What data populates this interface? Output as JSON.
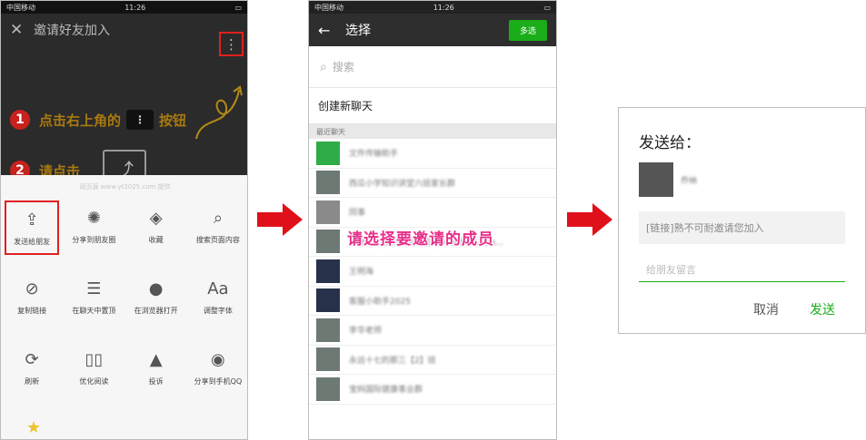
{
  "panel1": {
    "status": {
      "carrier": "中国移动",
      "time": "11:26"
    },
    "header": {
      "title": "邀请好友加入"
    },
    "step1": {
      "number": "1",
      "text_before": "点击右上角的",
      "text_after": "按钮"
    },
    "step2": {
      "number": "2",
      "text": "请点击"
    },
    "watermark": "阅页源 www.yt2025.com 提供",
    "menu": [
      {
        "label": "发送给朋友",
        "icon": "share-icon"
      },
      {
        "label": "分享到朋友圈",
        "icon": "moments-icon"
      },
      {
        "label": "收藏",
        "icon": "cube-icon"
      },
      {
        "label": "搜索页面内容",
        "icon": "search-icon"
      },
      {
        "label": "复制链接",
        "icon": "link-icon"
      },
      {
        "label": "在聊天中置顶",
        "icon": "pin-icon"
      },
      {
        "label": "在浏览器打开",
        "icon": "globe-icon"
      },
      {
        "label": "调整字体",
        "icon": "font-icon"
      },
      {
        "label": "刷新",
        "icon": "refresh-icon"
      },
      {
        "label": "优化阅读",
        "icon": "book-icon"
      },
      {
        "label": "投诉",
        "icon": "warning-icon"
      },
      {
        "label": "分享到手机QQ",
        "icon": "qq-icon"
      }
    ]
  },
  "panel2": {
    "status": {
      "carrier": "中国移动",
      "time": "11:26"
    },
    "nav": {
      "title": "选择",
      "multi_select": "多选"
    },
    "search": {
      "placeholder": "搜索"
    },
    "new_chat": "创建新聊天",
    "section": "最近聊天",
    "overlay": "请选择要邀请的成员",
    "contacts": [
      {
        "name": "文件传输助手",
        "avatar": "green"
      },
      {
        "name": "西瓜小学知识讲堂六班家长群",
        "avatar": "gray"
      },
      {
        "name": "同事",
        "avatar": "gray"
      },
      {
        "name": "王丽娟，陈子可妈，蓝天 + 家族群，wo...",
        "avatar": "gray"
      },
      {
        "name": "王明海",
        "avatar": "navy"
      },
      {
        "name": "客服小助手2025",
        "avatar": "navy"
      },
      {
        "name": "李华老师",
        "avatar": "gray"
      },
      {
        "name": "永远十七的那三【2】班",
        "avatar": "gray"
      },
      {
        "name": "宝妈国际健康事业群",
        "avatar": "gray"
      }
    ]
  },
  "panel3": {
    "title": "发送给：",
    "recipient": "乔纳",
    "link_text": "[链接]熟不可耐邀请您加入",
    "message_placeholder": "给朋友留言",
    "cancel": "取消",
    "send": "发送"
  }
}
